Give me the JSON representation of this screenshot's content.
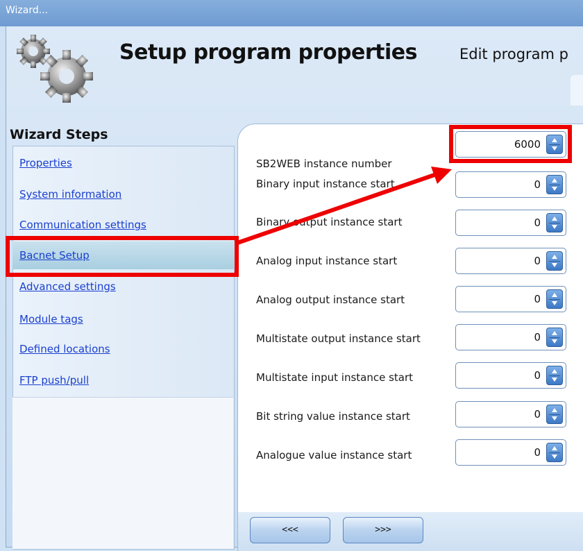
{
  "window": {
    "title": "Wizard..."
  },
  "header": {
    "title": "Setup program properties",
    "subtitle": "Edit program p",
    "icon": "gears-icon"
  },
  "sidebar": {
    "title": "Wizard Steps",
    "items": [
      {
        "label": "Properties"
      },
      {
        "label": "System information"
      },
      {
        "label": "Communication settings"
      },
      {
        "label": "Bacnet Setup"
      },
      {
        "label": "Advanced settings"
      },
      {
        "label": "Module tags"
      },
      {
        "label": "Defined locations"
      },
      {
        "label": "FTP push/pull"
      }
    ],
    "active_index": 3
  },
  "form": {
    "rows": [
      {
        "label": "SB2WEB instance number",
        "value": "6000"
      },
      {
        "label": "Binary input instance start",
        "value": "0"
      },
      {
        "label": "Binary output instance start",
        "value": "0"
      },
      {
        "label": "Analog input instance start",
        "value": "0"
      },
      {
        "label": "Analog output instance start",
        "value": "0"
      },
      {
        "label": "Multistate output instance start",
        "value": "0"
      },
      {
        "label": "Multistate input instance start",
        "value": "0"
      },
      {
        "label": "Bit string value instance start",
        "value": "0"
      },
      {
        "label": "Analogue value instance start",
        "value": "0"
      }
    ]
  },
  "footer": {
    "back_label": "<<<",
    "next_label": ">>>"
  },
  "annotation": {
    "highlight_color": "#ee0000",
    "accent_color": "#3d78c6"
  }
}
